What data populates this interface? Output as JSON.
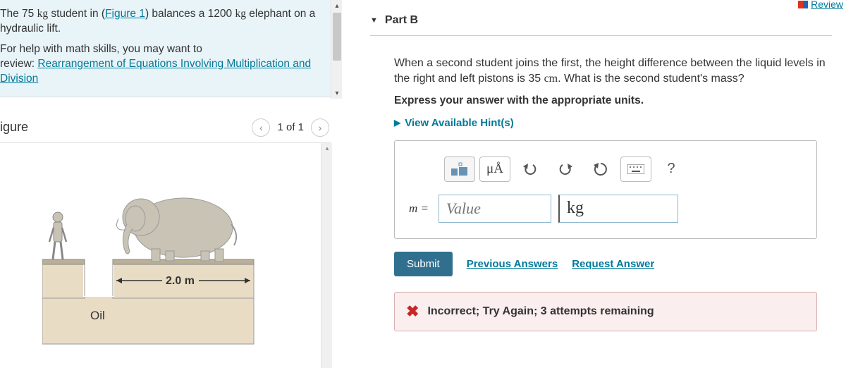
{
  "left": {
    "problem_line1_pre": "The 75 ",
    "problem_line1_unit1": "kg",
    "problem_line1_mid": " student in (",
    "figure_link": "Figure 1",
    "problem_line1_post": ") balances a 1200 ",
    "problem_line1_unit2": "kg",
    "problem_line2": "elephant on a hydraulic lift.",
    "help_line1": "For help with math skills, you may want to",
    "help_line2_pre": "review: ",
    "help_link": "Rearrangement of Equations Involving Multiplication and Division",
    "figure_title": "igure",
    "pager_text": "1 of 1",
    "fig_distance": "2.0 m",
    "fig_oil": "Oil"
  },
  "right": {
    "review": "Review",
    "part_title": "Part B",
    "question_pre": "When a second student joins the first, the height difference between the liquid levels in the right and left pistons is 35 ",
    "question_unit": "cm",
    "question_post": ". What is the second student's mass?",
    "express": "Express your answer with the appropriate units.",
    "hints": "View Available Hint(s)",
    "mu_label": "μÅ",
    "var": "m =",
    "value_placeholder": "Value",
    "unit_value": "kg",
    "submit": "Submit",
    "prev_answers": "Previous Answers",
    "request_answer": "Request Answer",
    "feedback": "Incorrect; Try Again; 3 attempts remaining"
  }
}
